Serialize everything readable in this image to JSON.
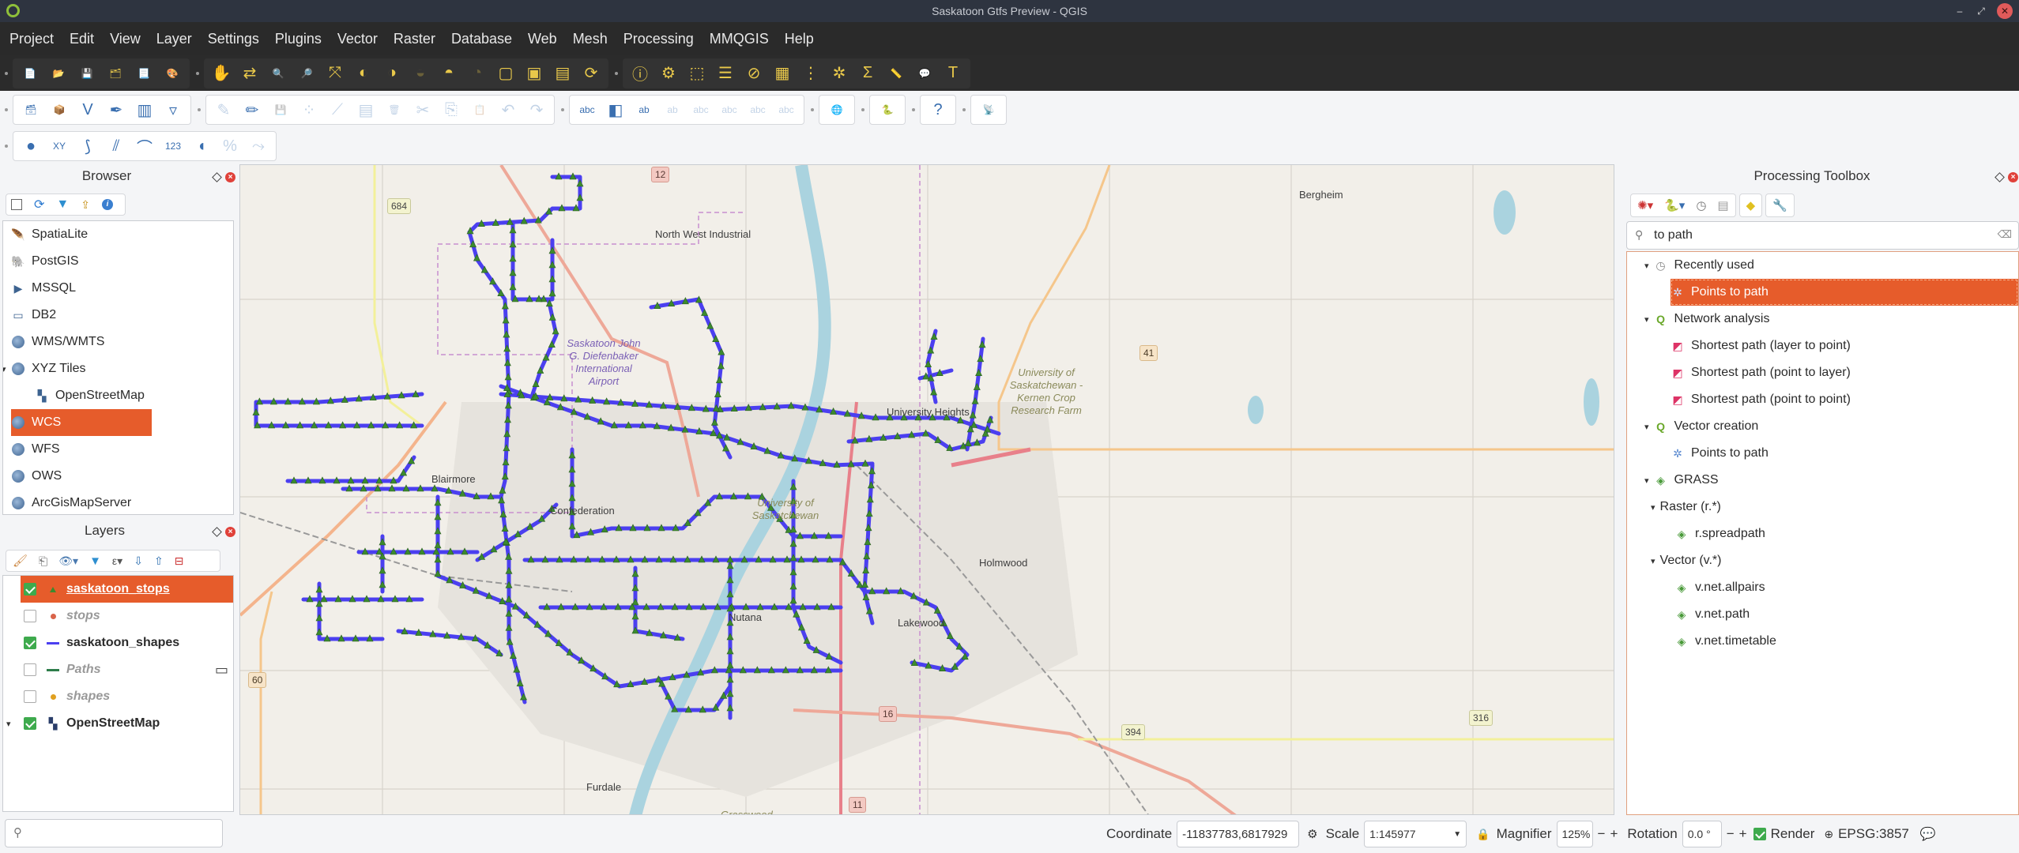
{
  "window": {
    "title": "Saskatoon Gtfs Preview - QGIS",
    "controls": {
      "minimize": "‒",
      "maximize": "⤢",
      "close": "✕"
    }
  },
  "menu": [
    "Project",
    "Edit",
    "View",
    "Layer",
    "Settings",
    "Plugins",
    "Vector",
    "Raster",
    "Database",
    "Web",
    "Mesh",
    "Processing",
    "MMQGIS",
    "Help"
  ],
  "toolbars": {
    "row1": [
      {
        "name": "new-project-icon",
        "glyph": "📄"
      },
      {
        "name": "open-project-icon",
        "glyph": "📂"
      },
      {
        "name": "save-project-icon",
        "glyph": "💾"
      },
      {
        "name": "save-as-icon",
        "glyph": "🗂"
      },
      {
        "name": "print-layout-icon",
        "glyph": "📃"
      },
      {
        "name": "style-manager-icon",
        "glyph": "🎨"
      },
      {
        "name": "pan-icon",
        "glyph": "✋"
      },
      {
        "name": "pan-to-selection-icon",
        "glyph": "⇄"
      },
      {
        "name": "zoom-in-icon",
        "glyph": "🔍"
      },
      {
        "name": "zoom-out-icon",
        "glyph": "🔎"
      },
      {
        "name": "zoom-full-icon",
        "glyph": "⤧"
      },
      {
        "name": "zoom-to-selection-icon",
        "glyph": "◐"
      },
      {
        "name": "zoom-to-layer-icon",
        "glyph": "◑"
      },
      {
        "name": "zoom-native-icon",
        "glyph": "◒"
      },
      {
        "name": "zoom-last-icon",
        "glyph": "◓"
      },
      {
        "name": "zoom-next-icon",
        "glyph": "◔"
      },
      {
        "name": "new-map-view-icon",
        "glyph": "▢"
      },
      {
        "name": "new-3d-view-icon",
        "glyph": "▣"
      },
      {
        "name": "bookmark-icon",
        "glyph": "▤"
      },
      {
        "name": "refresh-icon",
        "glyph": "⟳"
      },
      {
        "name": "identify-icon",
        "glyph": "ⓘ"
      },
      {
        "name": "run-action-icon",
        "glyph": "⚙"
      },
      {
        "name": "select-features-icon",
        "glyph": "⬚"
      },
      {
        "name": "select-by-value-icon",
        "glyph": "☰"
      },
      {
        "name": "deselect-icon",
        "glyph": "⊘"
      },
      {
        "name": "attribute-table-icon",
        "glyph": "▦"
      },
      {
        "name": "field-calculator-icon",
        "glyph": "⋮"
      },
      {
        "name": "processing-toolbox-icon",
        "glyph": "✲"
      },
      {
        "name": "statistical-summary-icon",
        "glyph": "Σ"
      },
      {
        "name": "measure-icon",
        "glyph": "📏"
      },
      {
        "name": "map-tips-icon",
        "glyph": "💬"
      },
      {
        "name": "text-annotation-icon",
        "glyph": "T"
      }
    ],
    "row2": [
      {
        "name": "data-source-manager-icon",
        "glyph": "🗃"
      },
      {
        "name": "new-geopackage-icon",
        "glyph": "📦"
      },
      {
        "name": "new-shapefile-icon",
        "glyph": "V"
      },
      {
        "name": "new-spatialite-icon",
        "glyph": "✒"
      },
      {
        "name": "new-temp-layer-icon",
        "glyph": "▥"
      },
      {
        "name": "new-virtual-layer-icon",
        "glyph": "▿"
      },
      {
        "name": "current-edits-icon",
        "glyph": "✎"
      },
      {
        "name": "toggle-editing-icon",
        "glyph": "✏"
      },
      {
        "name": "save-edits-icon",
        "glyph": "💾"
      },
      {
        "name": "add-feature-icon",
        "glyph": "⁘"
      },
      {
        "name": "vertex-tool-icon",
        "glyph": "⟋"
      },
      {
        "name": "modify-attributes-icon",
        "glyph": "▤"
      },
      {
        "name": "delete-selected-icon",
        "glyph": "🗑"
      },
      {
        "name": "cut-icon",
        "glyph": "✂"
      },
      {
        "name": "copy-icon",
        "glyph": "⎘"
      },
      {
        "name": "paste-icon",
        "glyph": "📋"
      },
      {
        "name": "undo-icon",
        "glyph": "↶"
      },
      {
        "name": "redo-icon",
        "glyph": "↷"
      },
      {
        "name": "label-toolbar-icon",
        "glyph": "abc"
      },
      {
        "name": "diagram-options-icon",
        "glyph": "◧"
      },
      {
        "name": "highlight-labels-icon",
        "glyph": "ab"
      },
      {
        "name": "pin-labels-icon",
        "glyph": "ab"
      },
      {
        "name": "show-hide-labels-icon",
        "glyph": "abc"
      },
      {
        "name": "move-label-icon",
        "glyph": "abc"
      },
      {
        "name": "rotate-label-icon",
        "glyph": "abc"
      },
      {
        "name": "change-label-icon",
        "glyph": "abc"
      },
      {
        "name": "metasearch-icon",
        "glyph": "🌐"
      },
      {
        "name": "python-console-icon",
        "glyph": "🐍"
      },
      {
        "name": "help-icon",
        "glyph": "?"
      },
      {
        "name": "gps-plugin-icon",
        "glyph": "📡"
      }
    ],
    "row3": [
      {
        "name": "snapping-icon",
        "glyph": "●"
      },
      {
        "name": "advanced-digitize-xy-icon",
        "glyph": "XY"
      },
      {
        "name": "trace-icon",
        "glyph": "⟆"
      },
      {
        "name": "split-icon",
        "glyph": "⫽"
      },
      {
        "name": "offset-icon",
        "glyph": "⌒"
      },
      {
        "name": "number-icon",
        "glyph": "123"
      },
      {
        "name": "reshape-icon",
        "glyph": "◖"
      },
      {
        "name": "topology-icon",
        "glyph": "%"
      },
      {
        "name": "node-tool-icon",
        "glyph": "⤳"
      }
    ]
  },
  "browser": {
    "title": "Browser",
    "items": [
      {
        "label": "SpatiaLite",
        "icon": "feather-icon",
        "indent": 0
      },
      {
        "label": "PostGIS",
        "icon": "elephant-icon",
        "indent": 0
      },
      {
        "label": "MSSQL",
        "icon": "mssql-icon",
        "indent": 0
      },
      {
        "label": "DB2",
        "icon": "db2-icon",
        "indent": 0
      },
      {
        "label": "WMS/WMTS",
        "icon": "globe-icon",
        "indent": 0
      },
      {
        "label": "XYZ Tiles",
        "icon": "globe-icon",
        "indent": 0,
        "expanded": true
      },
      {
        "label": "OpenStreetMap",
        "icon": "tiles-icon",
        "indent": 1
      },
      {
        "label": "WCS",
        "icon": "globe-icon",
        "indent": 0,
        "selected": true
      },
      {
        "label": "WFS",
        "icon": "globe-icon",
        "indent": 0
      },
      {
        "label": "OWS",
        "icon": "globe-icon",
        "indent": 0
      },
      {
        "label": "ArcGisMapServer",
        "icon": "globe-icon",
        "indent": 0
      }
    ]
  },
  "layers": {
    "title": "Layers",
    "items": [
      {
        "label": "saskatoon_stops",
        "checked": true,
        "symbol": "triangle",
        "symbol_color": "#3c8a2e",
        "selected": true,
        "bold": true,
        "underline": true
      },
      {
        "label": "stops",
        "checked": false,
        "symbol": "dot",
        "symbol_color": "#d9644a",
        "italic": true
      },
      {
        "label": "saskatoon_shapes",
        "checked": true,
        "symbol": "line",
        "symbol_color": "#4b3ff0",
        "bold": true
      },
      {
        "label": "Paths",
        "checked": false,
        "symbol": "line",
        "symbol_color": "#2e7d4a",
        "italic": true,
        "memory_layer": true
      },
      {
        "label": "shapes",
        "checked": false,
        "symbol": "dot",
        "symbol_color": "#e0a020",
        "italic": true
      },
      {
        "label": "OpenStreetMap",
        "checked": true,
        "symbol": "tiles",
        "bold": true,
        "expanded": true
      }
    ]
  },
  "locator": {
    "placeholder": ""
  },
  "map": {
    "route_color": "#4b3ff0",
    "stop_color": "#3c8a2e",
    "place_labels": [
      {
        "text": "North West Industrial"
      },
      {
        "text": "Saskatoon John G. Diefenbaker International Airport"
      },
      {
        "text": "University Heights"
      },
      {
        "text": "University of Saskatchewan - Kernen Crop Research Farm"
      },
      {
        "text": "Bergheim"
      },
      {
        "text": "Blairmore"
      },
      {
        "text": "Confederation"
      },
      {
        "text": "University of Saskatchewan"
      },
      {
        "text": "Holmwood"
      },
      {
        "text": "Nutana"
      },
      {
        "text": "Lakewood"
      },
      {
        "text": "Furdale"
      },
      {
        "text": "Grasswood"
      }
    ],
    "road_shields": [
      "12",
      "684",
      "41",
      "60",
      "16",
      "394",
      "316",
      "11"
    ]
  },
  "toolbox": {
    "title": "Processing Toolbox",
    "search_value": "to path",
    "tree": [
      {
        "label": "Recently used",
        "level": 0,
        "icon": "clock-icon",
        "expanded": true
      },
      {
        "label": "Points to path",
        "level": 1,
        "icon": "gear-icon",
        "selected": true
      },
      {
        "label": "Network analysis",
        "level": 0,
        "icon": "qgis-icon",
        "expanded": true
      },
      {
        "label": "Shortest path (layer to point)",
        "level": 1,
        "icon": "network-icon"
      },
      {
        "label": "Shortest path (point to layer)",
        "level": 1,
        "icon": "network-icon"
      },
      {
        "label": "Shortest path (point to point)",
        "level": 1,
        "icon": "network-icon"
      },
      {
        "label": "Vector creation",
        "level": 0,
        "icon": "qgis-icon",
        "expanded": true
      },
      {
        "label": "Points to path",
        "level": 1,
        "icon": "gear-icon"
      },
      {
        "label": "GRASS",
        "level": 0,
        "icon": "grass-icon",
        "expanded": true
      },
      {
        "label": "Raster (r.*)",
        "level": 1,
        "icon": "",
        "expanded": true
      },
      {
        "label": "r.spreadpath",
        "level": 2,
        "icon": "grass-icon"
      },
      {
        "label": "Vector (v.*)",
        "level": 1,
        "icon": "",
        "expanded": true
      },
      {
        "label": "v.net.allpairs",
        "level": 2,
        "icon": "grass-icon"
      },
      {
        "label": "v.net.path",
        "level": 2,
        "icon": "grass-icon"
      },
      {
        "label": "v.net.timetable",
        "level": 2,
        "icon": "grass-icon"
      }
    ]
  },
  "status": {
    "coordinate_label": "Coordinate",
    "coordinate_value": "-11837783,6817929",
    "scale_label": "Scale",
    "scale_value": "1:145977",
    "magnifier_label": "Magnifier",
    "magnifier_value": "125%",
    "rotation_label": "Rotation",
    "rotation_value": "0.0 °",
    "render_label": "Render",
    "render_checked": true,
    "crs": "EPSG:3857"
  }
}
